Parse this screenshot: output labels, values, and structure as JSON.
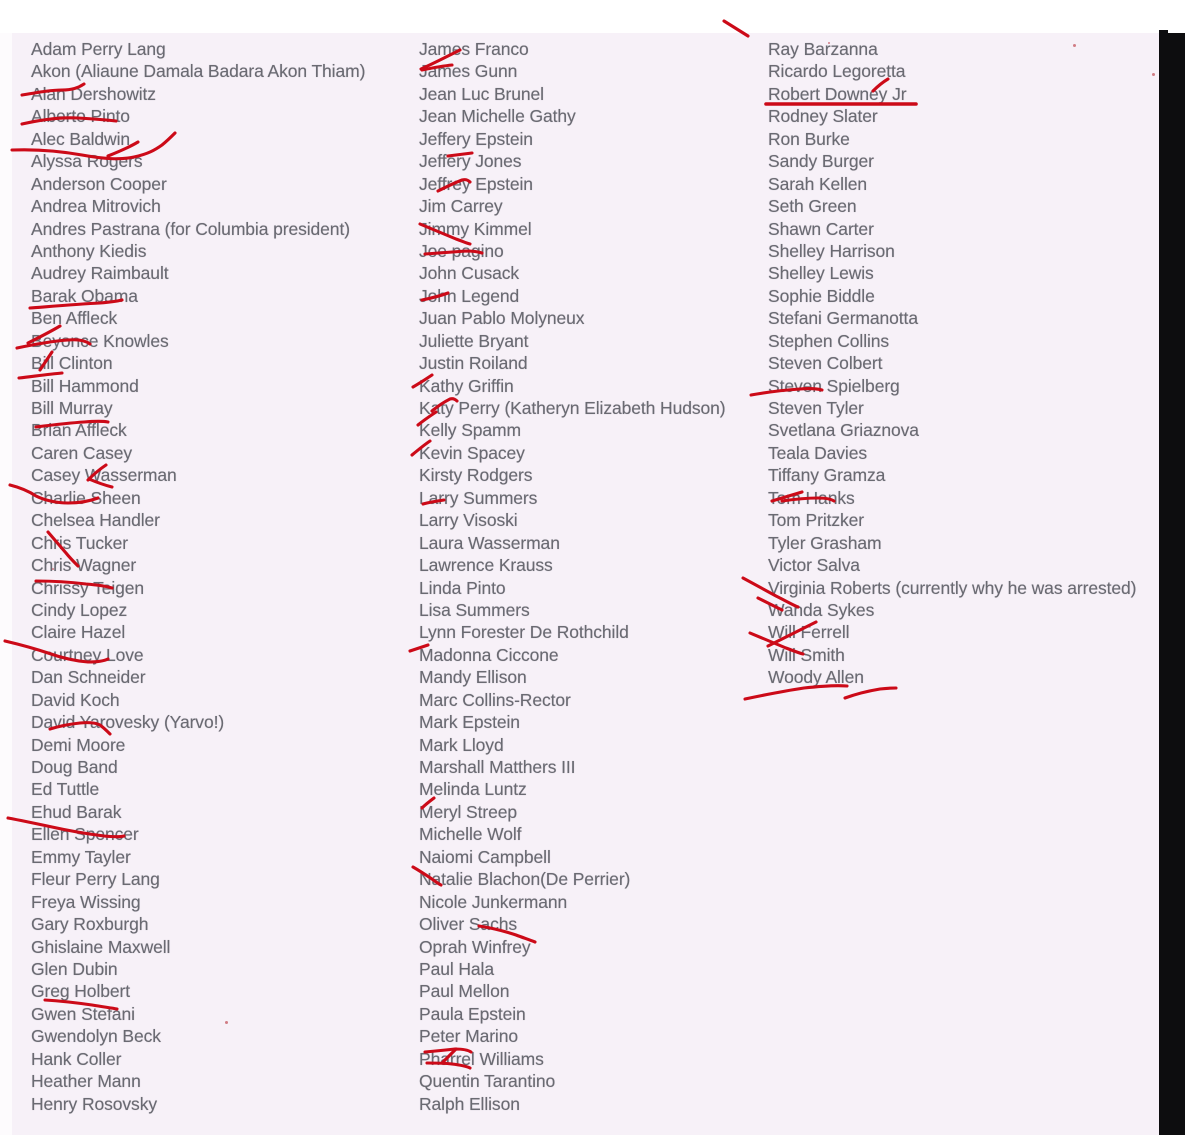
{
  "document": {
    "type": "scanned-list-page",
    "title": "Handwritten-annotated name list (3 columns)",
    "paper_color": "#f7f1f8",
    "text_color": "#6a6a72",
    "ink_color": "#cc0a18",
    "scan_edge_color": "#0d0d0f"
  },
  "columns": [
    {
      "id": "column-1",
      "names": [
        "Adam Perry Lang",
        "Akon (Aliaune Damala Badara Akon Thiam)",
        "Alan Dershowitz",
        "Alberto Pinto",
        "Alec Baldwin",
        "Alyssa Rogers",
        "Anderson Cooper",
        "Andrea Mitrovich",
        "Andres Pastrana (for Columbia president)",
        "Anthony Kiedis",
        "Audrey Raimbault",
        "Barak Obama",
        "Ben Affleck",
        "Beyonce Knowles",
        "Bill Clinton",
        "Bill Hammond",
        "Bill Murray",
        "Brian Affleck",
        "Caren Casey",
        "Casey Wasserman",
        "Charlie Sheen",
        "Chelsea Handler",
        "Chris Tucker",
        "Chris Wagner",
        "Chrissy Teigen",
        "Cindy Lopez",
        "Claire Hazel",
        "Courtney Love",
        "Dan Schneider",
        "David Koch",
        "David Yarovesky (Yarvo!)",
        "Demi Moore",
        "Doug Band",
        "Ed Tuttle",
        "Ehud Barak",
        "Ellen Spencer",
        "Emmy Tayler",
        "Fleur Perry Lang",
        "Freya Wissing",
        "Gary Roxburgh",
        "Ghislaine Maxwell",
        "Glen Dubin",
        "Greg Holbert",
        "Gwen Stefani",
        "Gwendolyn Beck",
        "Hank Coller",
        "Heather Mann",
        "Henry Rosovsky"
      ]
    },
    {
      "id": "column-2",
      "names": [
        "James Franco",
        "James Gunn",
        "Jean Luc Brunel",
        "Jean Michelle Gathy",
        "Jeffery Epstein",
        "Jeffery Jones",
        "Jeffrey Epstein",
        "Jim Carrey",
        "Jimmy Kimmel",
        "Joe pagino",
        "John Cusack",
        "John Legend",
        "Juan Pablo Molyneux",
        "Juliette Bryant",
        "Justin Roiland",
        "Kathy Griffin",
        "Katy Perry (Katheryn Elizabeth Hudson)",
        "Kelly Spamm",
        "Kevin Spacey",
        "Kirsty Rodgers",
        "Larry Summers",
        "Larry Visoski",
        "Laura Wasserman",
        "Lawrence Krauss",
        "Linda Pinto",
        "Lisa Summers",
        "Lynn Forester De Rothchild",
        "Madonna Ciccone",
        "Mandy Ellison",
        "Marc Collins-Rector",
        "Mark Epstein",
        "Mark Lloyd",
        "Marshall Matthers III",
        "Melinda Luntz",
        "Meryl Streep",
        "Michelle Wolf",
        "Naiomi Campbell",
        "Natalie Blachon(De Perrier)",
        "Nicole Junkermann",
        "Oliver Sachs",
        "Oprah Winfrey",
        "Paul Hala",
        "Paul Mellon",
        "Paula Epstein",
        "Peter Marino",
        "Pharrel Williams",
        "Quentin Tarantino",
        "Ralph Ellison"
      ]
    },
    {
      "id": "column-3",
      "names": [
        "Ray Barzanna",
        "Ricardo Legoretta",
        "Robert Downey Jr",
        "Rodney Slater",
        "Ron Burke",
        "Sandy Burger",
        "Sarah Kellen",
        "Seth Green",
        "Shawn Carter",
        "Shelley Harrison",
        "Shelley Lewis",
        "Sophie Biddle",
        "Stefani Germanotta",
        "Stephen Collins",
        "Steven Colbert",
        "Steven Spielberg",
        "Steven Tyler",
        "Svetlana Griaznova",
        "Teala Davies",
        "Tiffany Gramza",
        "Tom Hanks",
        "Tom Pritzker",
        "Tyler Grasham",
        "Victor Salva",
        "Virginia Roberts (currently why he was arrested)",
        "Wanda Sykes",
        "Will Ferrell",
        "Will Smith",
        "Woody Allen"
      ]
    }
  ],
  "annotations": {
    "ink_color": "#cc0a18",
    "description": "Red hand-drawn pen strokes (underlines, slashes and check-like marks) over selected names",
    "marked_names": [
      "Alan Dershowitz",
      "Alberto Pinto",
      "Alec Baldwin",
      "Alyssa Rogers",
      "Ben Affleck",
      "Beyonce Knowles",
      "Bill Clinton",
      "Bill Hammond",
      "Brian Affleck",
      "Casey Wasserman",
      "Charlie Sheen",
      "Chris Tucker",
      "Chrissy Teigen",
      "Courtney Love",
      "Demi Moore",
      "Ellen Spencer",
      "Gwen Stefani",
      "James Franco",
      "James Gunn",
      "Jeffery Jones",
      "Jeffrey Epstein",
      "Jimmy Kimmel",
      "Joe pagino",
      "John Legend",
      "Kathy Griffin",
      "Katy Perry (Katheryn Elizabeth Hudson)",
      "Kelly Spamm",
      "Kevin Spacey",
      "Larry Summers",
      "Madonna Ciccone",
      "Michelle Wolf",
      "Natalie Blachon(De Perrier)",
      "Oprah Winfrey",
      "Pharrel Williams",
      "Quentin Tarantino",
      "Robert Downey Jr",
      "Steven Tyler",
      "Tom Hanks",
      "Virginia Roberts (currently why he was arrested)",
      "Wanda Sykes",
      "Will Ferrell",
      "Will Smith"
    ]
  }
}
